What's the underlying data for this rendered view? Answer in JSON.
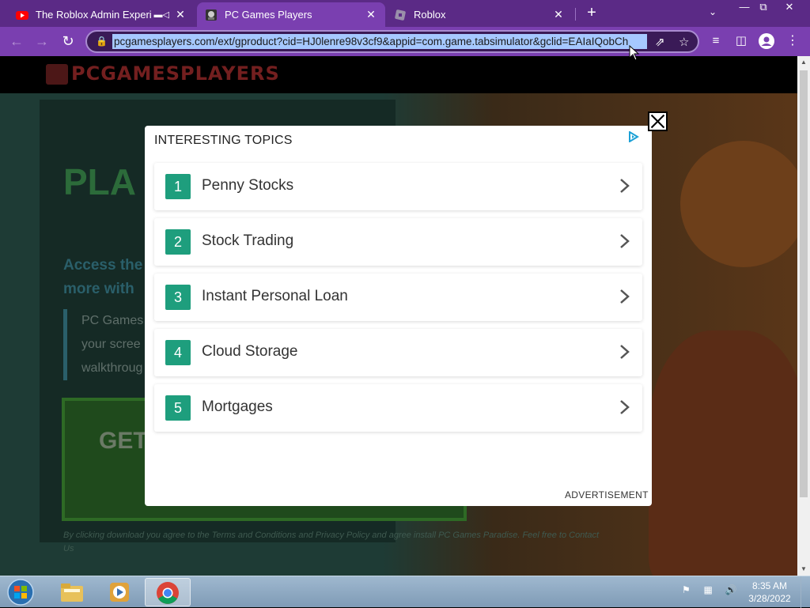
{
  "browser": {
    "tabs": [
      {
        "title": "The Roblox Admin Experience",
        "favicon": "youtube-icon",
        "muted": true,
        "active": false
      },
      {
        "title": "PC Games Players",
        "favicon": "pcgames-icon",
        "active": true
      },
      {
        "title": "Roblox",
        "favicon": "roblox-icon",
        "active": false
      }
    ],
    "url": "pcgamesplayers.com/ext/gproduct?cid=HJ0lenre98v3cf9&appid=com.game.tabsimulator&gclid=EAIaIQobCh",
    "accent": "#7a3fb0",
    "tabbar_color": "#5b2a86"
  },
  "site": {
    "logo": "PCGAMESPLAYERS",
    "hero_title": "PLA",
    "hero_sub": "Access the more with",
    "hero_desc": "PC Games your scree walkthroug",
    "cta": "GET B",
    "legal": "By clicking download you agree to the Terms and Conditions and Privacy Policy and agree install PC Games Paradise. Feel free to Contact Us"
  },
  "ad": {
    "heading": "INTERESTING TOPICS",
    "label": "ADVERTISEMENT",
    "accent": "#1e9e7d",
    "topics": [
      {
        "num": "1",
        "label": "Penny Stocks"
      },
      {
        "num": "2",
        "label": "Stock Trading"
      },
      {
        "num": "3",
        "label": "Instant Personal Loan"
      },
      {
        "num": "4",
        "label": "Cloud Storage"
      },
      {
        "num": "5",
        "label": "Mortgages"
      }
    ]
  },
  "taskbar": {
    "time": "8:35 AM",
    "date": "3/28/2022",
    "apps": [
      "explorer-icon",
      "media-player-icon",
      "chrome-icon"
    ]
  }
}
